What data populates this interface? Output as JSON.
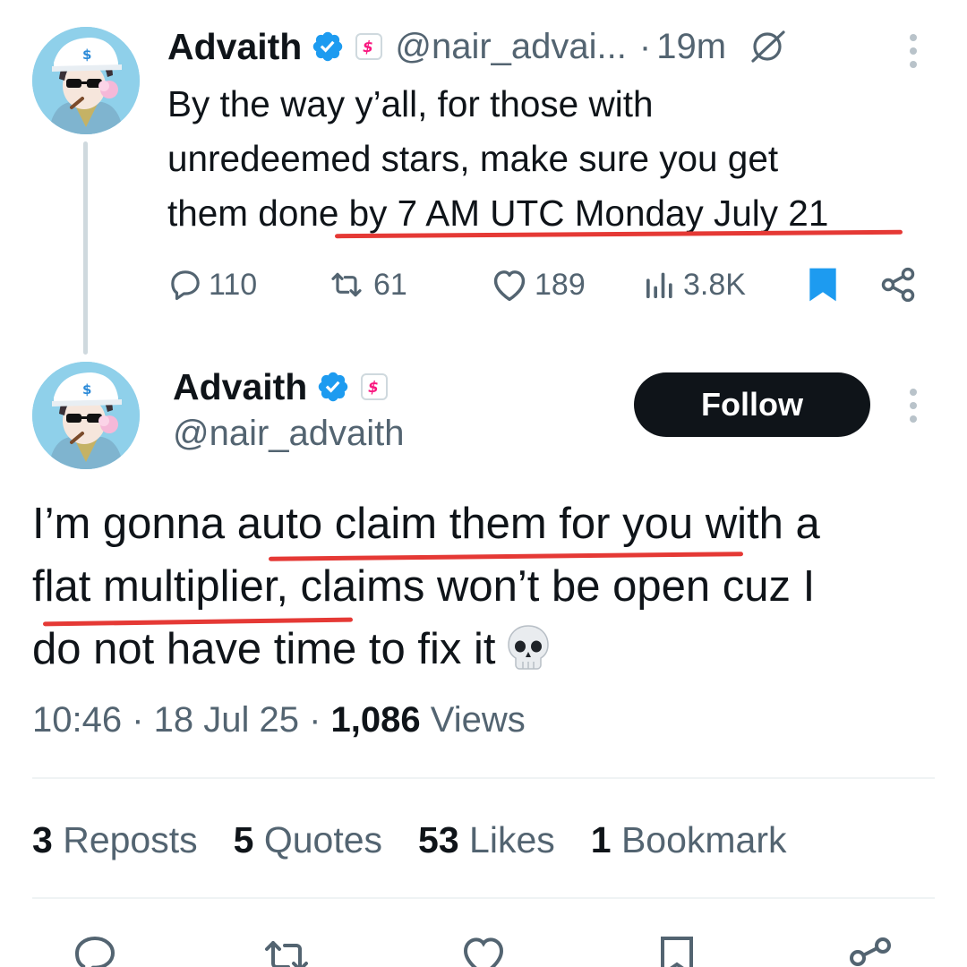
{
  "parent_tweet": {
    "author_name": "Advaith",
    "handle": "@nair_advai...",
    "dot": "·",
    "time": "19m",
    "text_lines": [
      "By the way y’all, for those with",
      "unredeemed stars, make sure you get",
      "them done by 7 AM UTC Monday July 21"
    ],
    "actions": {
      "replies": "110",
      "reposts": "61",
      "likes": "189",
      "views": "3.8K"
    },
    "bookmarked": true
  },
  "main_tweet": {
    "author_name": "Advaith",
    "handle": "@nair_advaith",
    "follow_label": "Follow",
    "text_lines": [
      "I’m gonna auto claim them for you with a",
      "flat multiplier, claims won’t be open cuz I",
      "do not have time to fix it"
    ],
    "emoji": "skull",
    "meta": {
      "time": "10:46",
      "sep1": " · ",
      "date": "18 Jul 25",
      "sep2": " · ",
      "views_count": "1,086",
      "views_label": " Views"
    },
    "stats": {
      "reposts_count": "3",
      "reposts_label": " Reposts",
      "quotes_count": "5",
      "quotes_label": " Quotes",
      "likes_count": "53",
      "likes_label": " Likes",
      "bookmarks_count": "1",
      "bookmarks_label": " Bookmark"
    }
  },
  "colors": {
    "verified_blue": "#1d9bf0",
    "annotation_red": "#e53935",
    "text_primary": "#0f1419",
    "text_secondary": "#536471",
    "follow_button_bg": "#0f1419",
    "subscription_badge": "#f91880"
  },
  "icons": {
    "verified": "verified-badge-icon",
    "subscription": "creator-subscription-icon",
    "grok": "grok-icon",
    "more": "more-dots-icon",
    "reply": "reply-icon",
    "repost": "repost-icon",
    "like": "heart-icon",
    "views": "views-chart-icon",
    "bookmark": "bookmark-icon",
    "share": "share-icon"
  }
}
